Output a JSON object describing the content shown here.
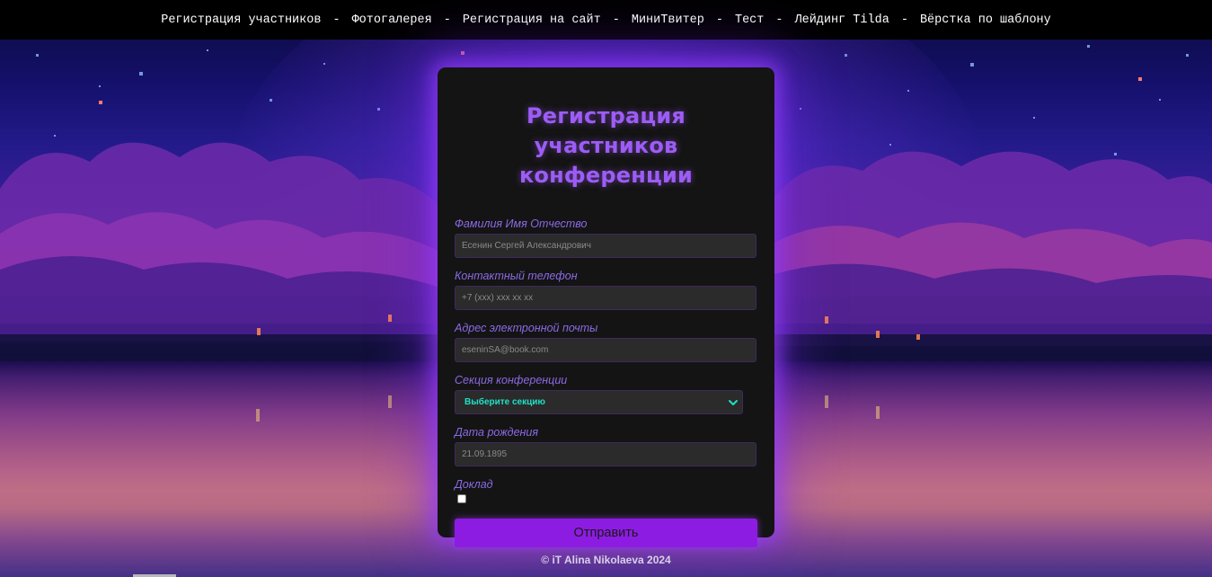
{
  "nav": {
    "items": [
      "Регистрация участников",
      "Фотогалерея",
      "Регистрация на сайт",
      "МиниТвитер",
      "Тест",
      "Лейдинг Tilda",
      "Вёрстка по шаблону"
    ],
    "separator": "-"
  },
  "form": {
    "title_line1": "Регистрация участников",
    "title_line2": "конференции",
    "fio": {
      "label": "Фамилия Имя Отчество",
      "placeholder": "Есенин Сергей Александрович"
    },
    "phone": {
      "label": "Контактный телефон",
      "placeholder": "+7 (xxx) xxx xx xx"
    },
    "email": {
      "label": "Адрес электронной почты",
      "placeholder": "eseninSA@book.com"
    },
    "section": {
      "label": "Секция конференции",
      "selected": "Выберите секцию",
      "icon": "chevron-down-icon"
    },
    "birthdate": {
      "label": "Дата рождения",
      "placeholder": "21.09.1895"
    },
    "report": {
      "label": "Доклад",
      "checked": false
    },
    "submit_label": "Отправить"
  },
  "footer": {
    "text": "© iT Alina Nikolaeva 2024"
  },
  "colors": {
    "accent": "#9d5cf5",
    "button": "#8d1ce2",
    "select_text": "#1fe0c8",
    "card_bg": "#141414",
    "nav_bg": "#000000"
  }
}
